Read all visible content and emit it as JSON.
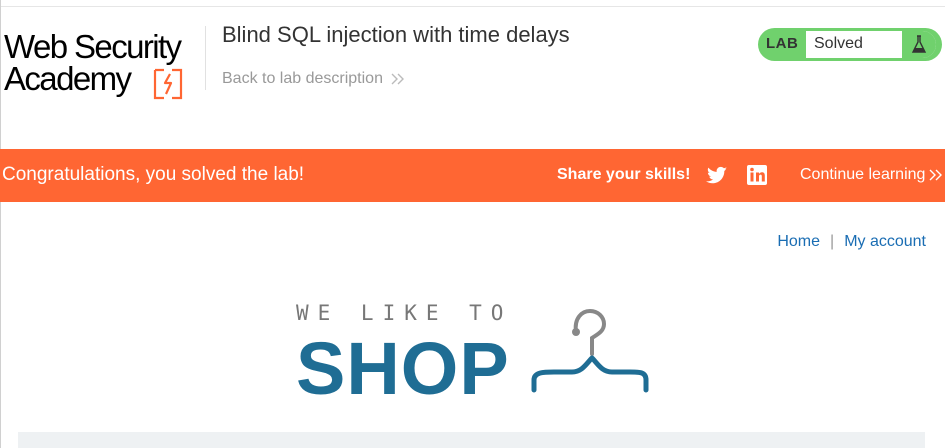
{
  "header": {
    "logo_line1": "Web Security",
    "logo_line2": "Academy",
    "lab_title": "Blind SQL injection with time delays",
    "back_link": "Back to lab description"
  },
  "status": {
    "tag": "LAB",
    "value": "Solved",
    "icon": "flask-icon"
  },
  "banner": {
    "message": "Congratulations, you solved the lab!",
    "share_label": "Share your skills!",
    "continue_label": "Continue learning"
  },
  "nav": {
    "home": "Home",
    "separator": "|",
    "account": "My account"
  },
  "shop": {
    "tagline": "WE LIKE TO",
    "word": "SHOP"
  },
  "colors": {
    "banner": "#ff6633",
    "status_green": "#70d16d",
    "link_blue": "#1a6db3",
    "shop_blue": "#1f6d94"
  }
}
